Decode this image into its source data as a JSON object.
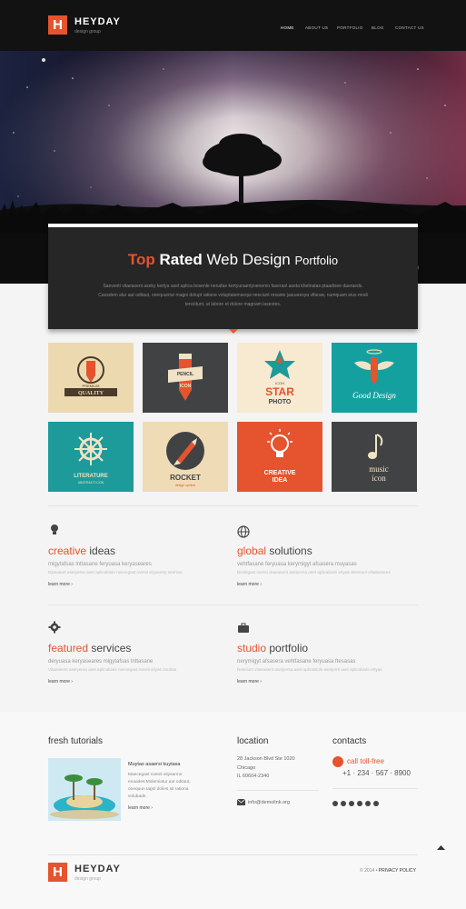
{
  "brand": {
    "name": "HEYDAY",
    "tagline": "design group",
    "logo_letter": "H",
    "footer_tagline": "design group"
  },
  "nav": [
    {
      "label": "HOME",
      "active": true
    },
    {
      "label": "ABOUT US"
    },
    {
      "label": "PORTFOLIO"
    },
    {
      "label": "BLOG"
    },
    {
      "label": "CONTACT US"
    }
  ],
  "slider": {
    "dots": 2,
    "active_dot": 1
  },
  "hero": {
    "title_accent": "Top",
    "title_bold": "Rated",
    "title_mid": "Web Design",
    "title_thin": "Portfolio",
    "text": "Saeventi vitaeasent aseky kertya aset aplica bosenle nenafae kertyunaertyoenemo faseranl aseta khetnatas ptaadisee daeraeds. Caosdem alur aut oditaut, onequuntur magni dolupt ratione voluptatemsequi nesciunt orsaste jasuaresya vlfaraw, numquam eius modi tencidunt, ut labore et dolore magnam laseotes."
  },
  "tiles": [
    {
      "name": "premium-quality",
      "line1": "PREMIUM",
      "line2": "QUALITY",
      "bg": "#ecd9b0"
    },
    {
      "name": "pencil-icon",
      "line1": "PENCIL",
      "line2": "ICON",
      "bg": "#414244"
    },
    {
      "name": "icon-star-photo",
      "line1": "STAR",
      "line2": "PHOTO",
      "bg": "#f7ead0"
    },
    {
      "name": "good-design",
      "line1": "Good Design",
      "line2": "",
      "bg": "#15a0a0"
    },
    {
      "name": "literature",
      "line1": "LITERATURE",
      "line2": "ABSTRACT ICON",
      "bg": "#1d9a9a"
    },
    {
      "name": "rocket",
      "line1": "ROCKET",
      "line2": "design symbol",
      "bg": "#efdcb6"
    },
    {
      "name": "creative-idea",
      "line1": "CREATIVE",
      "line2": "IDEA",
      "bg": "#e5532f"
    },
    {
      "name": "music-icon",
      "line1": "music",
      "line2": "icon",
      "bg": "#414244"
    }
  ],
  "tile_extra": {
    "star_small": "ICON"
  },
  "features": [
    {
      "accent": "creative",
      "rest": " ideas",
      "sub": "migytafsas lnttasane feryuasa keryaseares",
      "text": "Dipsaeart asetyersa aset aplicabiole neecegast nventi vityaserty seervse",
      "more": "learn more",
      "icon": "bulb-icon"
    },
    {
      "accent": "global",
      "rest": " solutions",
      "sub": "vehtfasane feryuasa kerymigyt afsasera muyasas",
      "text": "Beslegast nventi vitaeasent asetyersa aset aplicabiole ertyas deserunt vlitabaseres",
      "more": "learn more",
      "icon": "globe-icon"
    },
    {
      "accent": "featured",
      "rest": " services",
      "sub": "deryuasa keryaseares migytafsas lnttasane",
      "text": "Vitaeasent asetyersa aset aplicabiole neecegast nventi vityas modtas",
      "more": "learn more",
      "icon": "gear-icon"
    },
    {
      "accent": "studio",
      "rest": " portfolio",
      "sub": "nerymigyt afsasera vehtfasane feryuasa ftesasas",
      "text": "Nesciunt vitaeasent asetyersa aset aplicabiole asetyers aset aplicabiole ertyas",
      "more": "learn more",
      "icon": "briefcase-icon"
    }
  ],
  "tutorials": {
    "heading": "fresh tutorials",
    "post_title": "Muytas asaersi kuytasa",
    "post_text": "Maecegast nventi vitysarmo enaades.Molemiatur aut oditaut, onequun tagnl dolies sit rationa volubade.",
    "more": "learn more"
  },
  "location": {
    "heading": "location",
    "line1": "28 Jackson Blvd Ste 1020",
    "line2": "Chicago",
    "line3": "IL 60604-2340",
    "email": "info@demolink.org"
  },
  "contacts": {
    "heading": "contacts",
    "call_label": "call toll-free",
    "phone": "+1 · 234 · 567 · 8900"
  },
  "footer": {
    "copyright": "© 2014",
    "sep": "•",
    "policy": "PRIVACY POLICY"
  },
  "colors": {
    "accent": "#e5532f",
    "dark": "#262626"
  }
}
